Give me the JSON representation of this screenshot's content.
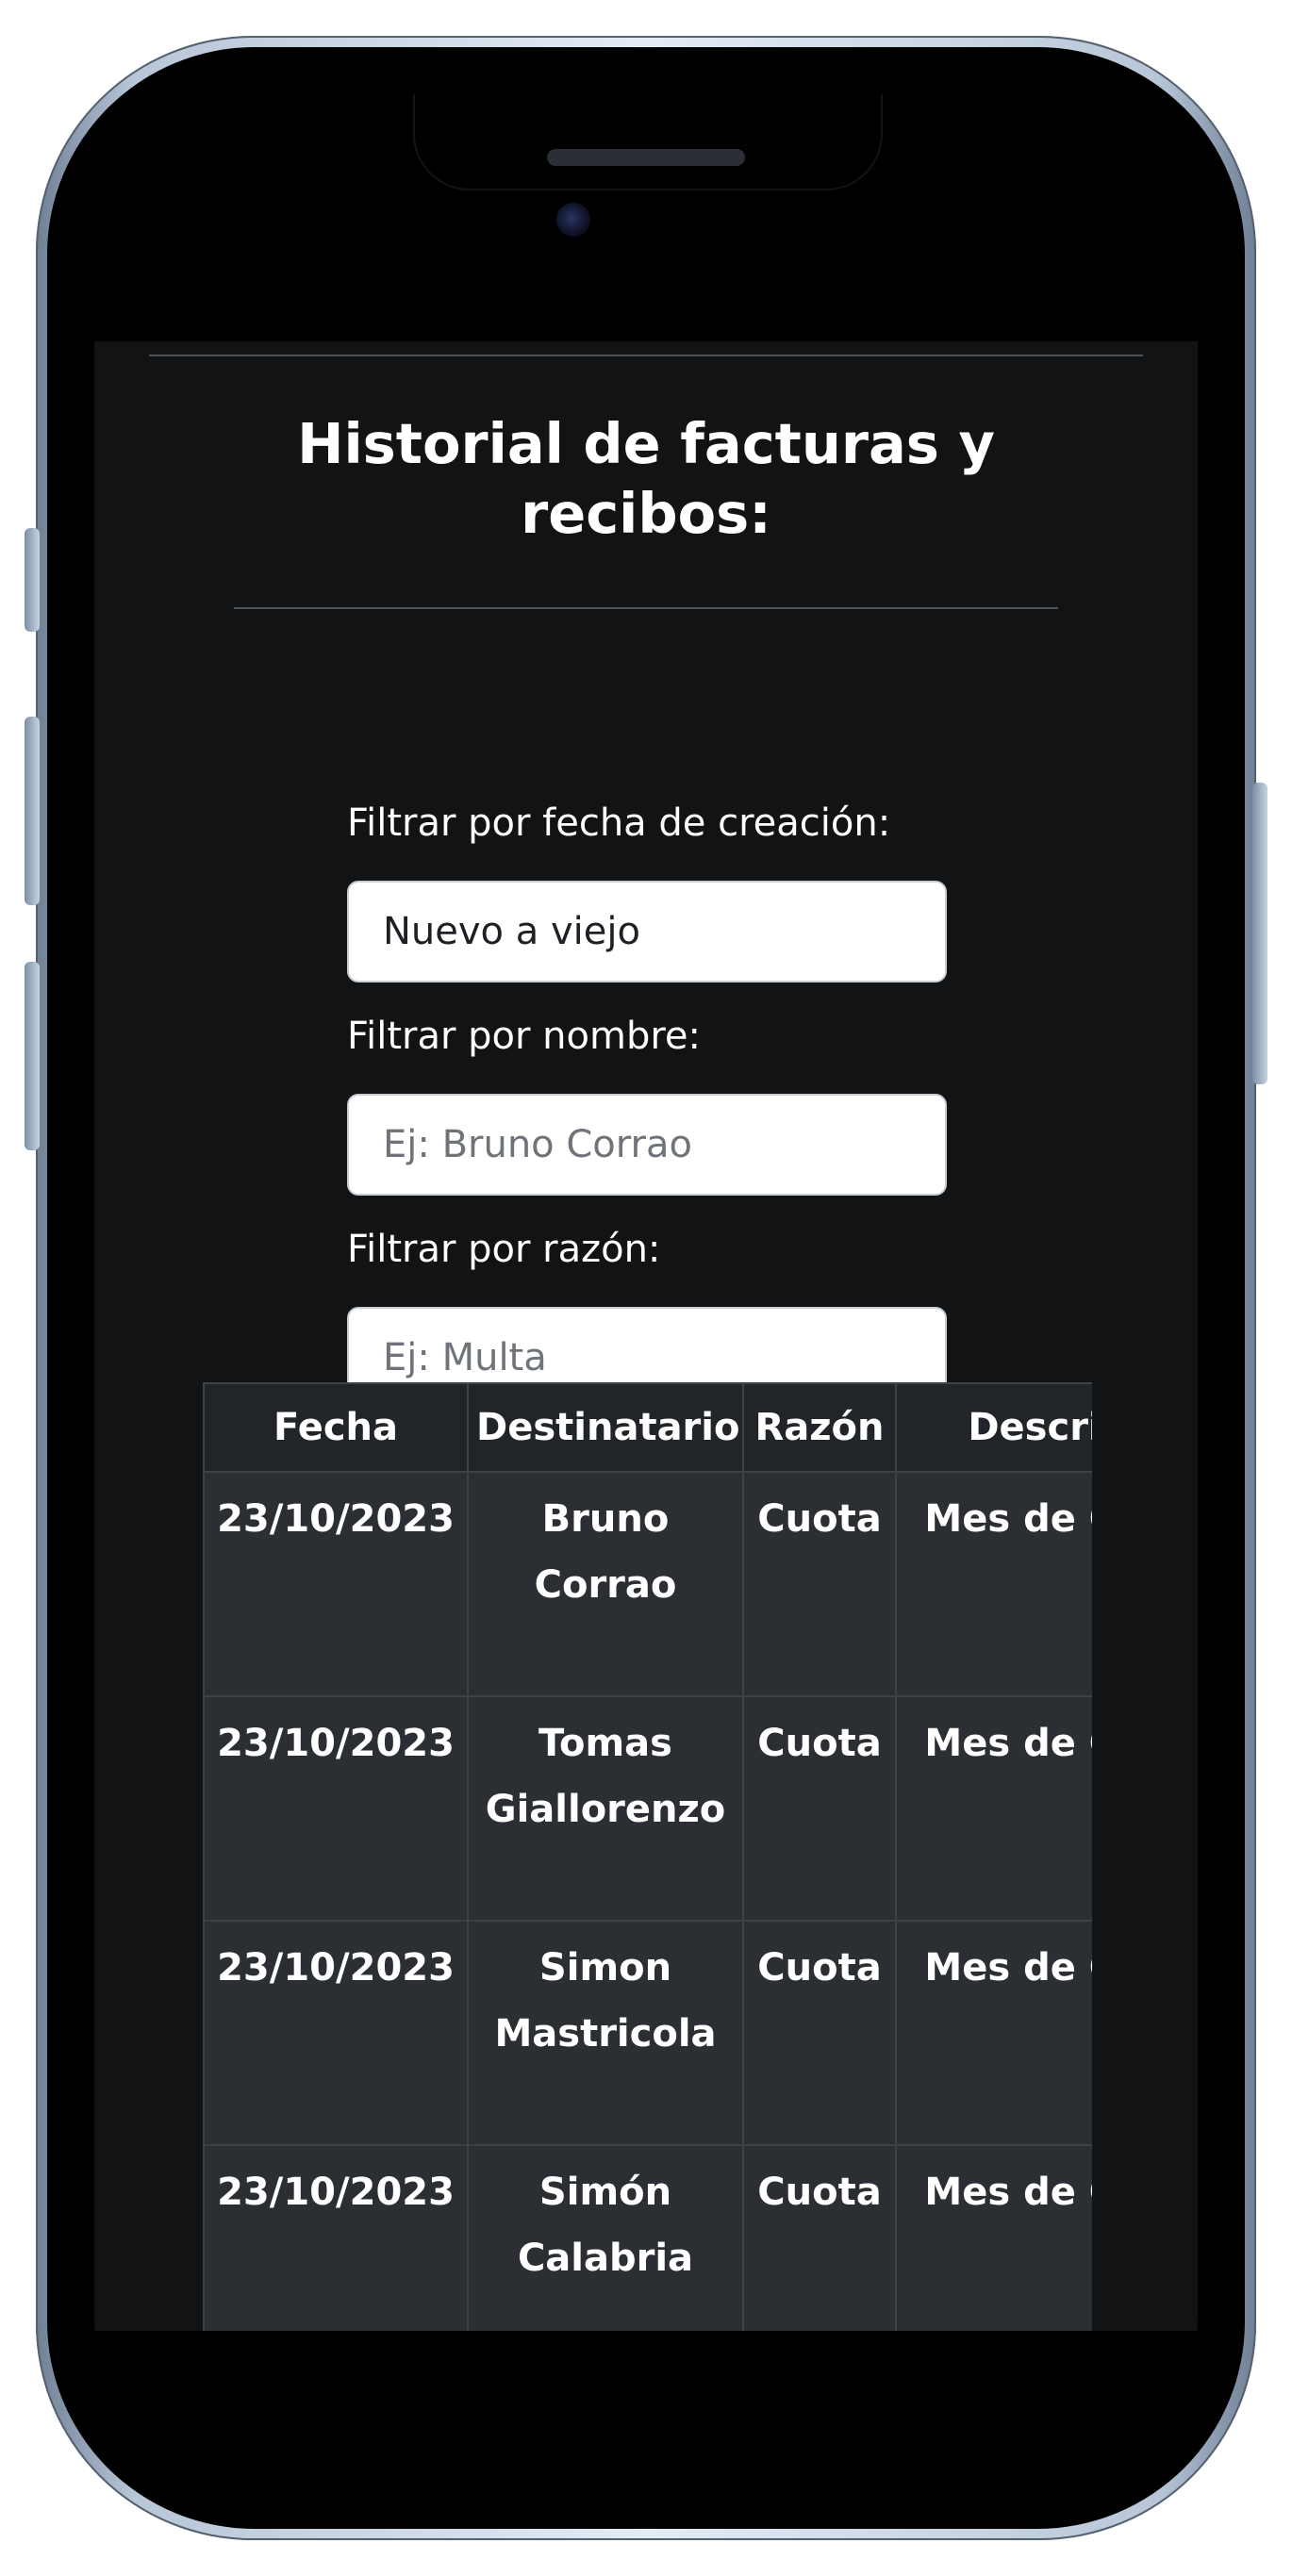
{
  "page": {
    "title": "Historial de facturas y recibos:"
  },
  "filters": {
    "date": {
      "label": "Filtrar por fecha de creación:",
      "value": "Nuevo a viejo"
    },
    "name": {
      "label": "Filtrar por nombre:",
      "placeholder": "Ej: Bruno Corrao"
    },
    "reason": {
      "label": "Filtrar por razón:",
      "placeholder": "Ej: Multa"
    }
  },
  "table": {
    "headers": [
      "Fecha",
      "Destinatario",
      "Razón",
      "Descripción"
    ],
    "rows": [
      {
        "fecha": "23/10/2023",
        "destinatario": "Bruno Corrao",
        "razon": "Cuota",
        "descripcion": "Mes de Octubre"
      },
      {
        "fecha": "23/10/2023",
        "destinatario": "Tomas Giallorenzo",
        "razon": "Cuota",
        "descripcion": "Mes de Octubre"
      },
      {
        "fecha": "23/10/2023",
        "destinatario": "Simon Mastricola",
        "razon": "Cuota",
        "descripcion": "Mes de Octubre"
      },
      {
        "fecha": "23/10/2023",
        "destinatario": "Simón Calabria",
        "razon": "Cuota",
        "descripcion": "Mes de Octubre"
      }
    ]
  },
  "colors": {
    "page_background": "#111315",
    "table_header": "#212529",
    "table_cell": "#2b2e33",
    "text": "#ffffff"
  }
}
